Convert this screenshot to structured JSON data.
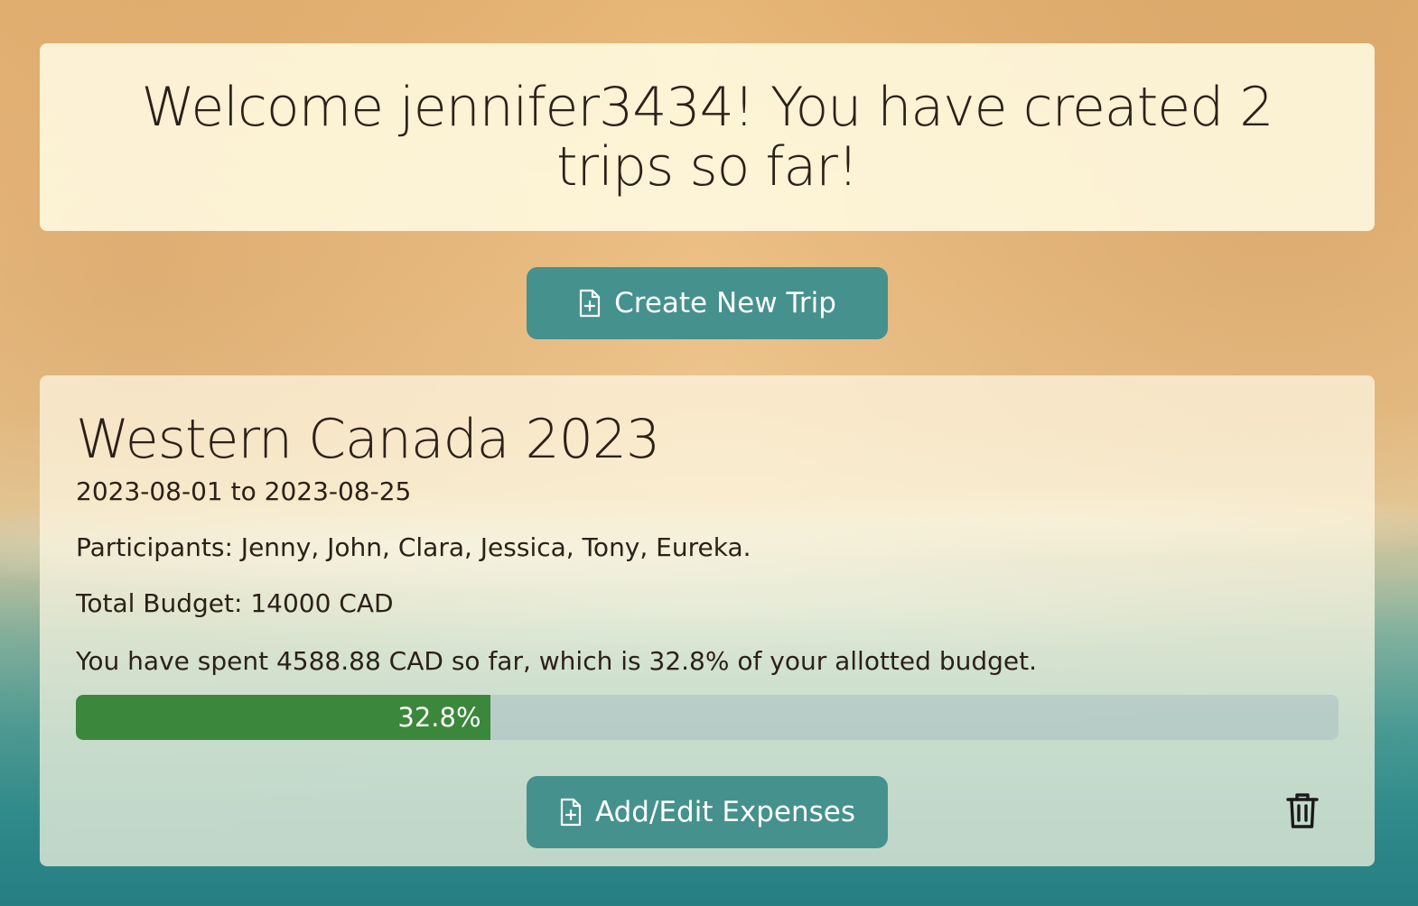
{
  "welcome": {
    "title": "Welcome jennifer3434! You have created 2 trips so far!"
  },
  "actions": {
    "create_trip_label": "Create New Trip",
    "create_trip_icon": "file-plus-icon"
  },
  "trip": {
    "name": "Western Canada 2023",
    "dates": "2023-08-01 to 2023-08-25",
    "participants": "Participants: Jenny, John, Clara, Jessica, Tony, Eureka.",
    "budget": "Total Budget: 14000 CAD",
    "spent_text": "You have spent 4588.88 CAD so far, which is 32.8% of your allotted budget.",
    "progress_percent": 32.8,
    "progress_label": "32.8%",
    "expenses_label": "Add/Edit Expenses",
    "expenses_icon": "file-plus-icon",
    "delete_icon": "trash-icon"
  },
  "colors": {
    "button": "#45918e",
    "progress_fill": "#3b873b",
    "text": "#2b2118"
  }
}
